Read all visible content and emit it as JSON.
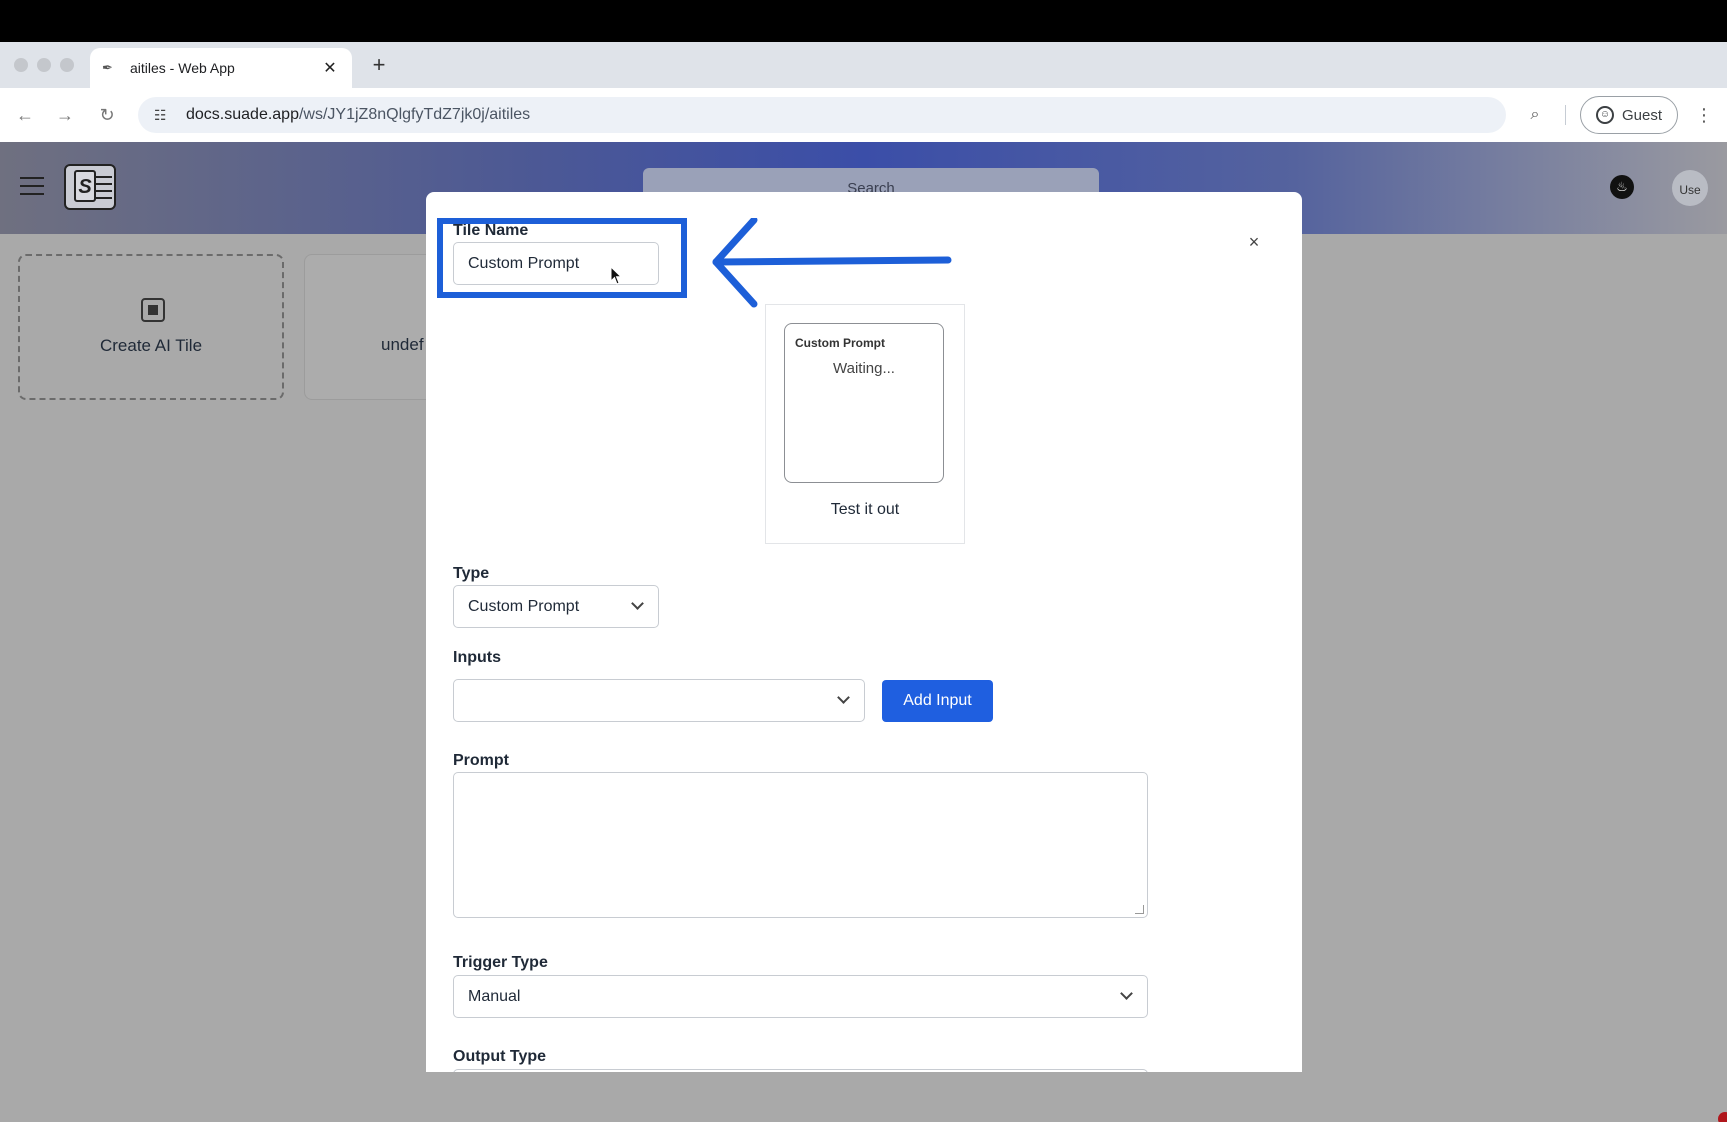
{
  "browser": {
    "tab_title": "aitiles - Web App",
    "tab_favicon": "feather-icon",
    "new_tab_label": "+",
    "url_host": "docs.suade.app",
    "url_path": "/ws/JY1jZ8nQlgfyTdZ7jk0j/aitiles",
    "profile_label": "Guest"
  },
  "app": {
    "search_placeholder": "Search",
    "user_avatar_alt": "Use",
    "cards": [
      {
        "label": "Create AI Tile"
      },
      {
        "label": "undef"
      }
    ]
  },
  "modal": {
    "close_label": "×",
    "tile_name": {
      "label": "Tile Name",
      "value": "Custom Prompt"
    },
    "preview": {
      "tile_title": "Custom Prompt",
      "status": "Waiting...",
      "caption": "Test it out"
    },
    "type": {
      "label": "Type",
      "value": "Custom Prompt"
    },
    "inputs": {
      "label": "Inputs",
      "value": "",
      "add_button": "Add Input"
    },
    "prompt": {
      "label": "Prompt",
      "value": ""
    },
    "trigger_type": {
      "label": "Trigger Type",
      "value": "Manual"
    },
    "output_type": {
      "label": "Output Type"
    }
  },
  "annotation": {
    "highlight_color": "#1d5fd8"
  }
}
